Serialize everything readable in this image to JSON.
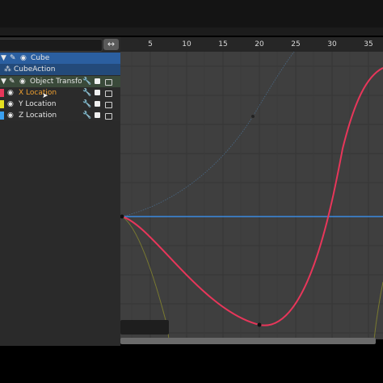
{
  "ruler": {
    "ticks": [
      "5",
      "10",
      "15",
      "20",
      "25",
      "30",
      "35"
    ]
  },
  "channels": {
    "object": "Cube",
    "action": "CubeAction",
    "group": "Object Transforms",
    "x": "X Location",
    "y": "Y Location",
    "z": "Z Location"
  },
  "colors": {
    "x_curve": "#e8365a",
    "y_curve": "#b8c040",
    "z_curve": "#3a8ae0",
    "selected_text": "#f0a030"
  },
  "icons": [
    "eye-icon",
    "pin-icon",
    "wrench-icon",
    "lock-icon",
    "checkbox-icon",
    "swap-icon",
    "cursor-icon"
  ]
}
